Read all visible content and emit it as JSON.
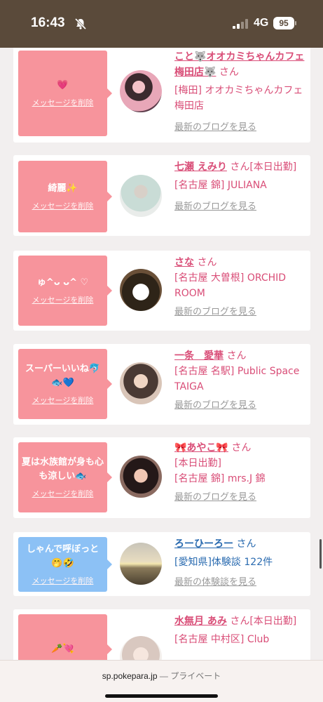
{
  "status": {
    "time": "16:43",
    "network": "4G",
    "battery": "95"
  },
  "cards": [
    {
      "message": "💗",
      "delete_label": "メッセージを削除",
      "name": "こと🐺オオカミちゃんカフェ梅田店🐺",
      "suffix": "さん",
      "shop": "[梅田] オオカミちゃんカフェ梅田店",
      "link": "最新のブログを見る",
      "color": "pink"
    },
    {
      "message": "綺麗✨",
      "delete_label": "メッセージを削除",
      "name": "七瀬 えみり",
      "suffix": "さん[本日出勤]",
      "shop": "[名古屋 錦] JULIANA",
      "link": "最新のブログを見る",
      "color": "pink"
    },
    {
      "message": "ゅ^ᴗ ᴗ^ ♡",
      "delete_label": "メッセージを削除",
      "name": "さな",
      "suffix": "さん",
      "shop": "[名古屋 大曽根] ORCHID ROOM",
      "link": "最新のブログを見る",
      "color": "pink"
    },
    {
      "message": "スーパーいいね🐬🐟💙",
      "delete_label": "メッセージを削除",
      "name": "一条　愛華",
      "suffix": "さん",
      "shop": "[名古屋 名駅] Public Space TAIGA",
      "link": "最新のブログを見る",
      "color": "pink"
    },
    {
      "message": "夏は水族館が身も心も涼しい🐟",
      "delete_label": "メッセージを削除",
      "name": "🎀あやこ🎀",
      "suffix": "さん",
      "status_line": "[本日出勤]",
      "shop": "[名古屋 錦] mrs.J 錦",
      "link": "最新のブログを見る",
      "color": "pink"
    },
    {
      "message": "しゃんで呼ぼっと🤭🤣",
      "delete_label": "メッセージを削除",
      "name": "ろーひーろー",
      "suffix": "さん",
      "shop": "[愛知県]体験談 122件",
      "link": "最新の体験談を見る",
      "color": "blue"
    },
    {
      "message": "🥕💘",
      "name": "水無月 あみ",
      "suffix": "さん[本日出勤]",
      "shop": "[名古屋 中村区] Club",
      "color": "pink"
    }
  ],
  "browser": {
    "url": "sp.pokepara.jp",
    "separator": "—",
    "mode": "プライベート"
  }
}
